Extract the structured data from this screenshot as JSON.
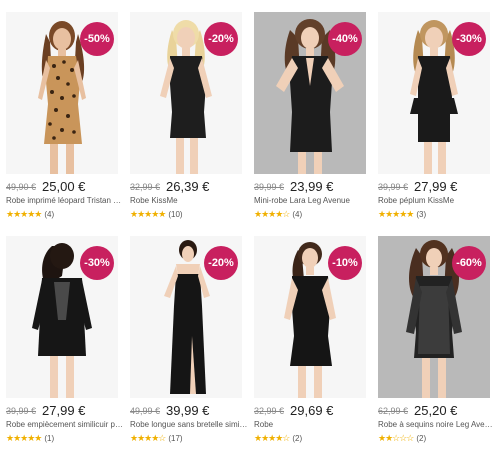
{
  "products": [
    {
      "discount": "-50%",
      "old_price": "49,90 €",
      "price": "25,00 €",
      "title": "Robe imprimé léopard Tristan F…",
      "stars": "★★★★★",
      "reviews": "(4)"
    },
    {
      "discount": "-20%",
      "old_price": "32,99 €",
      "price": "26,39 €",
      "title": "Robe KissMe",
      "stars": "★★★★★",
      "reviews": "(10)"
    },
    {
      "discount": "-40%",
      "old_price": "39,99 €",
      "price": "23,99 €",
      "title": "Mini-robe Lara Leg Avenue",
      "stars": "★★★★☆",
      "reviews": "(4)"
    },
    {
      "discount": "-30%",
      "old_price": "39,99 €",
      "price": "27,99 €",
      "title": "Robe péplum KissMe",
      "stars": "★★★★★",
      "reviews": "(3)"
    },
    {
      "discount": "-30%",
      "old_price": "39,99 €",
      "price": "27,99 €",
      "title": "Robe empiècement similicuir pe…",
      "stars": "★★★★★",
      "reviews": "(1)"
    },
    {
      "discount": "-20%",
      "old_price": "49,99 €",
      "price": "39,99 €",
      "title": "Robe longue sans bretelle simili…",
      "stars": "★★★★☆",
      "reviews": "(17)"
    },
    {
      "discount": "-10%",
      "old_price": "32,99 €",
      "price": "29,69 €",
      "title": "Robe",
      "stars": "★★★★☆",
      "reviews": "(2)"
    },
    {
      "discount": "-60%",
      "old_price": "62,99 €",
      "price": "25,20 €",
      "title": "Robe à sequins noire Leg Avenue",
      "stars": "★★☆☆☆",
      "reviews": "(2)"
    }
  ],
  "colors": {
    "badge": "#c8205f",
    "stars": "#f0b000"
  }
}
